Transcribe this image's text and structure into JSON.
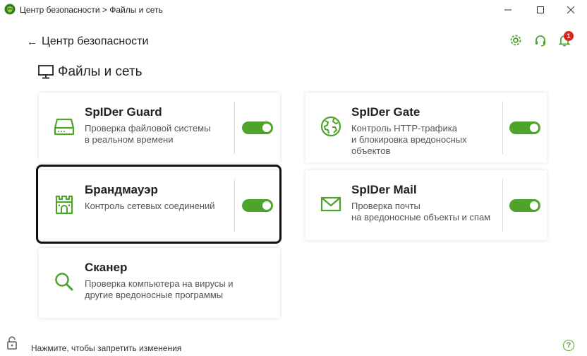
{
  "window": {
    "title": "Центр безопасности > Файлы и сеть"
  },
  "header": {
    "back_label": "Центр безопасности",
    "notification_count": "1"
  },
  "section": {
    "title": "Файлы и сеть"
  },
  "cards": {
    "guard": {
      "title": "SpIDer Guard",
      "desc": "Проверка файловой системы\nв реальном времени",
      "enabled": true
    },
    "gate": {
      "title": "SpIDer Gate",
      "desc": "Контроль HTTP-трафика\nи блокировка вредоносных\nобъектов",
      "enabled": true
    },
    "firewall": {
      "title": "Брандмауэр",
      "desc": "Контроль сетевых соединений",
      "enabled": true
    },
    "mail": {
      "title": "SpIDer Mail",
      "desc": "Проверка почты\nна вредоносные объекты и спам",
      "enabled": true
    },
    "scanner": {
      "title": "Сканер",
      "desc": "Проверка компьютера на вирусы и\nдругие вредоносные программы"
    }
  },
  "footer": {
    "lock_text": "Нажмите, чтобы запретить изменения",
    "help_label": "?"
  },
  "colors": {
    "accent": "#4ea32a",
    "badge": "#d9261c"
  }
}
